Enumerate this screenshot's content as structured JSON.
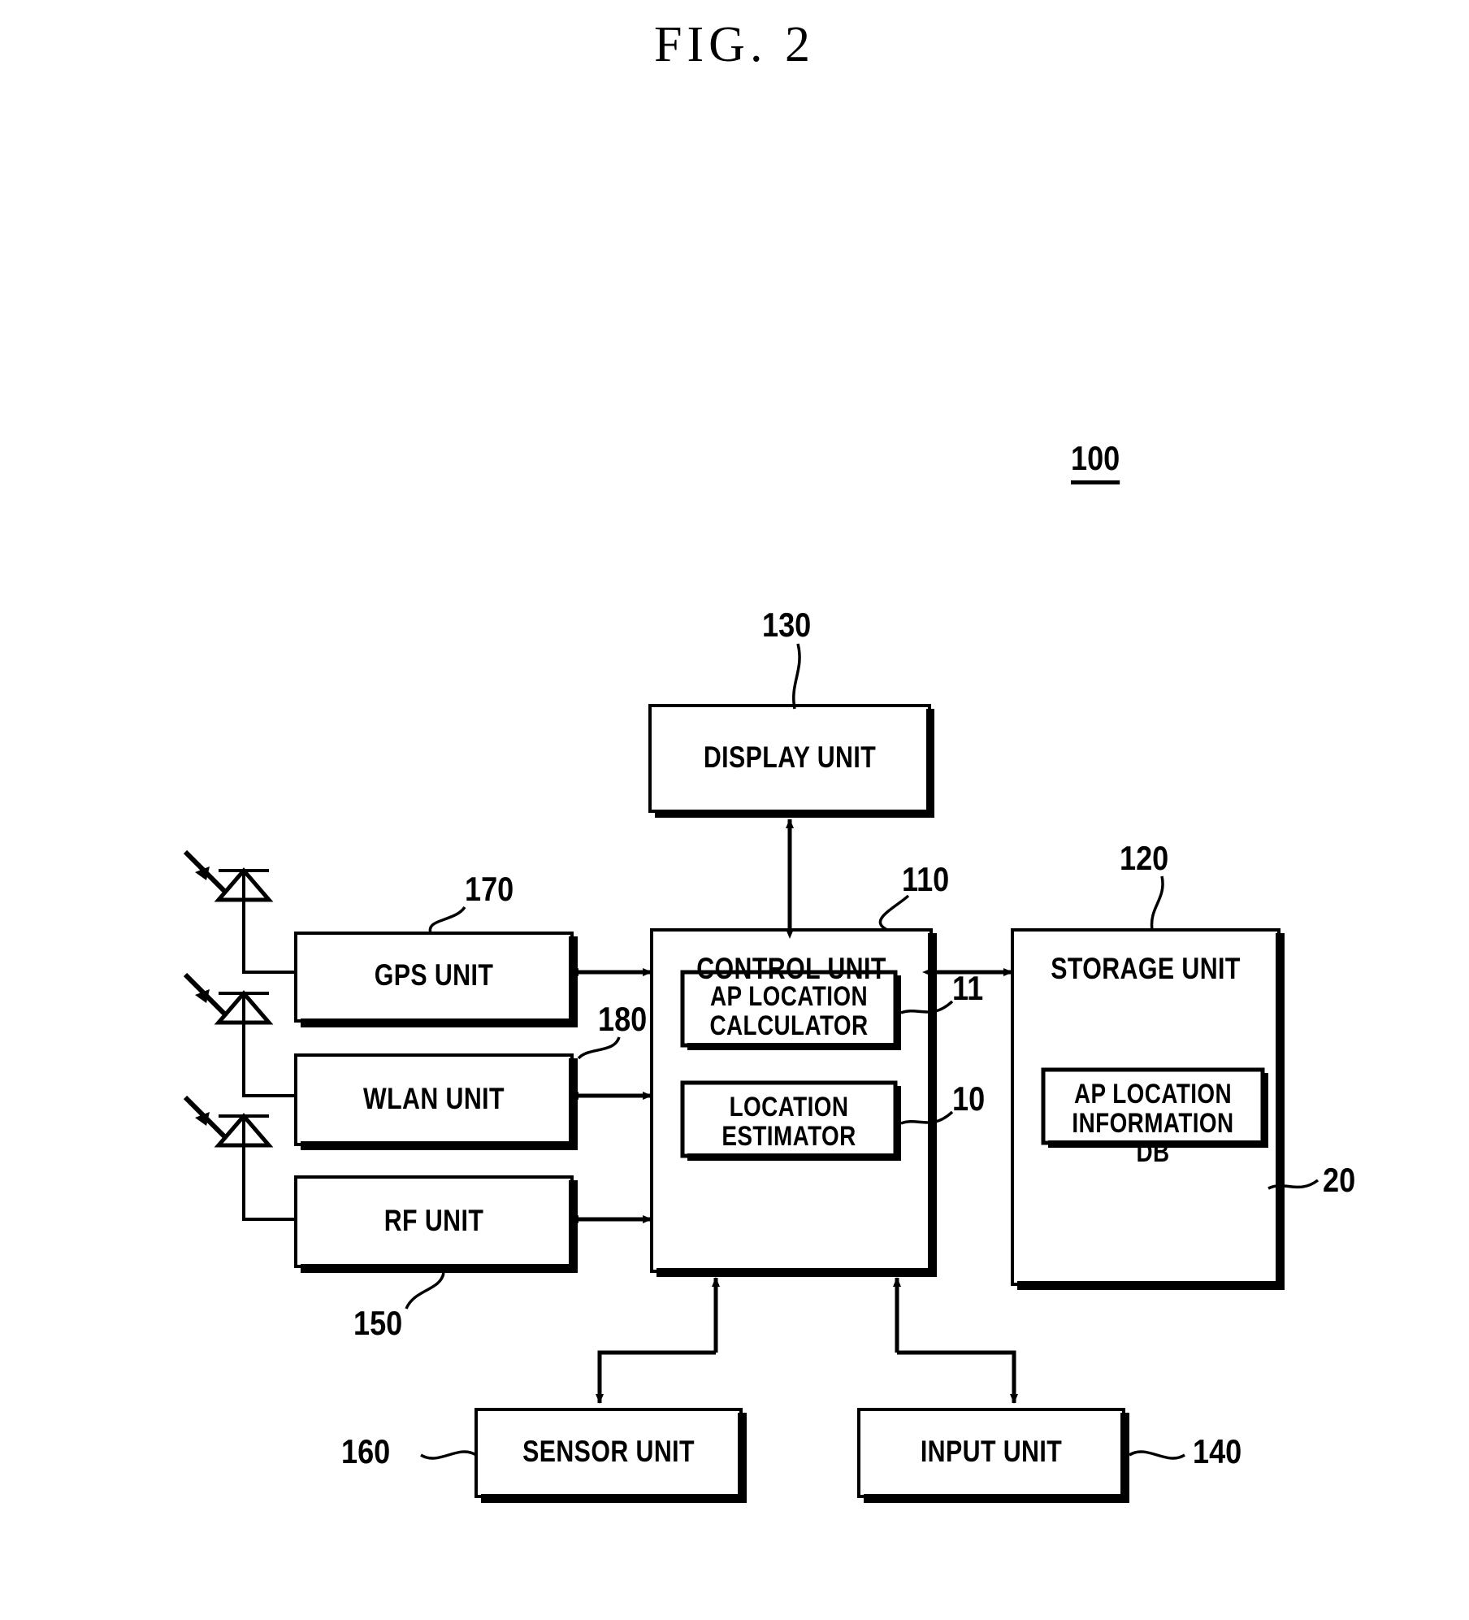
{
  "figure": {
    "title": "FIG. 2",
    "system_ref": "100"
  },
  "blocks": [
    {
      "id": "display",
      "label": "DISPLAY UNIT",
      "ref": "130"
    },
    {
      "id": "control",
      "label": "CONTROL UNIT",
      "ref": "110"
    },
    {
      "id": "storage",
      "label": "STORAGE UNIT",
      "ref": "120"
    },
    {
      "id": "gps",
      "label": "GPS UNIT",
      "ref": "170"
    },
    {
      "id": "wlan",
      "label": "WLAN UNIT",
      "ref": "180"
    },
    {
      "id": "rf",
      "label": "RF UNIT",
      "ref": "150"
    },
    {
      "id": "sensor",
      "label": "SENSOR UNIT",
      "ref": "160"
    },
    {
      "id": "input",
      "label": "INPUT UNIT",
      "ref": "140"
    }
  ],
  "sub_blocks": [
    {
      "id": "ap-location-calculator",
      "label": "AP LOCATION\nCALCULATOR",
      "ref": "11",
      "parent": "control"
    },
    {
      "id": "location-estimator",
      "label": "LOCATION\nESTIMATOR",
      "ref": "10",
      "parent": "control"
    },
    {
      "id": "ap-location-information-db",
      "label": "AP LOCATION\nINFORMATION DB",
      "ref": "20",
      "parent": "storage"
    }
  ],
  "antennas": [
    {
      "id": "antenna-gps",
      "connects_to": "gps"
    },
    {
      "id": "antenna-wlan",
      "connects_to": "wlan"
    },
    {
      "id": "antenna-rf",
      "connects_to": "rf"
    }
  ],
  "connections": [
    {
      "from": "control",
      "to": "display",
      "type": "bidirectional"
    },
    {
      "from": "control",
      "to": "storage",
      "type": "bidirectional"
    },
    {
      "from": "gps",
      "to": "control",
      "type": "bidirectional"
    },
    {
      "from": "wlan",
      "to": "control",
      "type": "bidirectional"
    },
    {
      "from": "rf",
      "to": "control",
      "type": "bidirectional"
    },
    {
      "from": "control",
      "to": "sensor",
      "type": "bidirectional"
    },
    {
      "from": "control",
      "to": "input",
      "type": "bidirectional"
    }
  ],
  "colors": {
    "stroke": "#000000",
    "background": "#ffffff"
  }
}
